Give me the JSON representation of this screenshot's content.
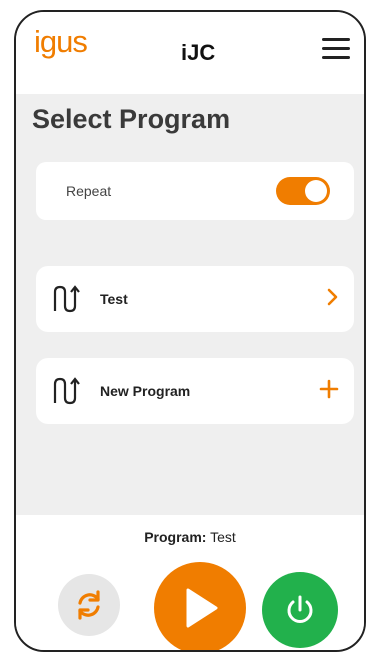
{
  "header": {
    "logo_text": "igus",
    "app_title": "iJC",
    "menu_icon": "hamburger-menu-icon"
  },
  "page": {
    "title": "Select Program"
  },
  "repeat": {
    "label": "Repeat",
    "enabled": true
  },
  "programs": [
    {
      "label": "Test",
      "icon": "program-wave-icon",
      "action_icon": "chevron-right-icon"
    },
    {
      "label": "New Program",
      "icon": "program-wave-icon",
      "action_icon": "plus-icon"
    }
  ],
  "footer": {
    "program_prefix": "Program:",
    "program_name": "Test",
    "buttons": [
      "sync-icon",
      "play-icon",
      "power-icon"
    ]
  },
  "colors": {
    "accent": "#f07d00",
    "power": "#22b14c",
    "background": "#efefef"
  }
}
